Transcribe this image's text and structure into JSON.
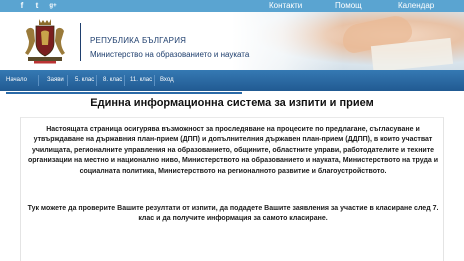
{
  "topbar": {
    "social": [
      {
        "icon": "facebook-icon",
        "glyph": "f"
      },
      {
        "icon": "twitter-icon",
        "glyph": "t"
      },
      {
        "icon": "google-plus-icon",
        "glyph": "g+"
      }
    ],
    "links": [
      "Контакти",
      "Помощ",
      "Календар"
    ]
  },
  "header": {
    "country": "РЕПУБЛИКА БЪЛГАРИЯ",
    "ministry": "Министерство на образованието и науката"
  },
  "nav": {
    "items": [
      "Начало",
      "Заяви",
      "5. клас",
      "8. клас",
      "11. клас",
      "Вход"
    ]
  },
  "main": {
    "title": "Единна информационна система за изпити и прием",
    "paragraph1": "Настоящата страница осигурява възможност за проследяване на процесите по предлагане, съгласуване и утвърждаване на държавния план-прием (ДПП) и допълнителния държавен план-прием (ДДПП), в които участват училищата, регионалните управления на образованието, общините, областните управи, работодателите и техните организации на местно и национално ниво, Министерството на образованието и науката, Министерството на труда и социалната политика, Министерството на регионалното развитие и благоустройството.",
    "paragraph2": "Тук можете да проверите Вашите резултати от изпити, да подадете Вашите заявления за участие в класиране след 7. клас и да получите информация за самото класиране."
  },
  "colors": {
    "topbar": "#5aa4d1",
    "nav": "#215a92",
    "ministry_text": "#1f3f6e"
  }
}
